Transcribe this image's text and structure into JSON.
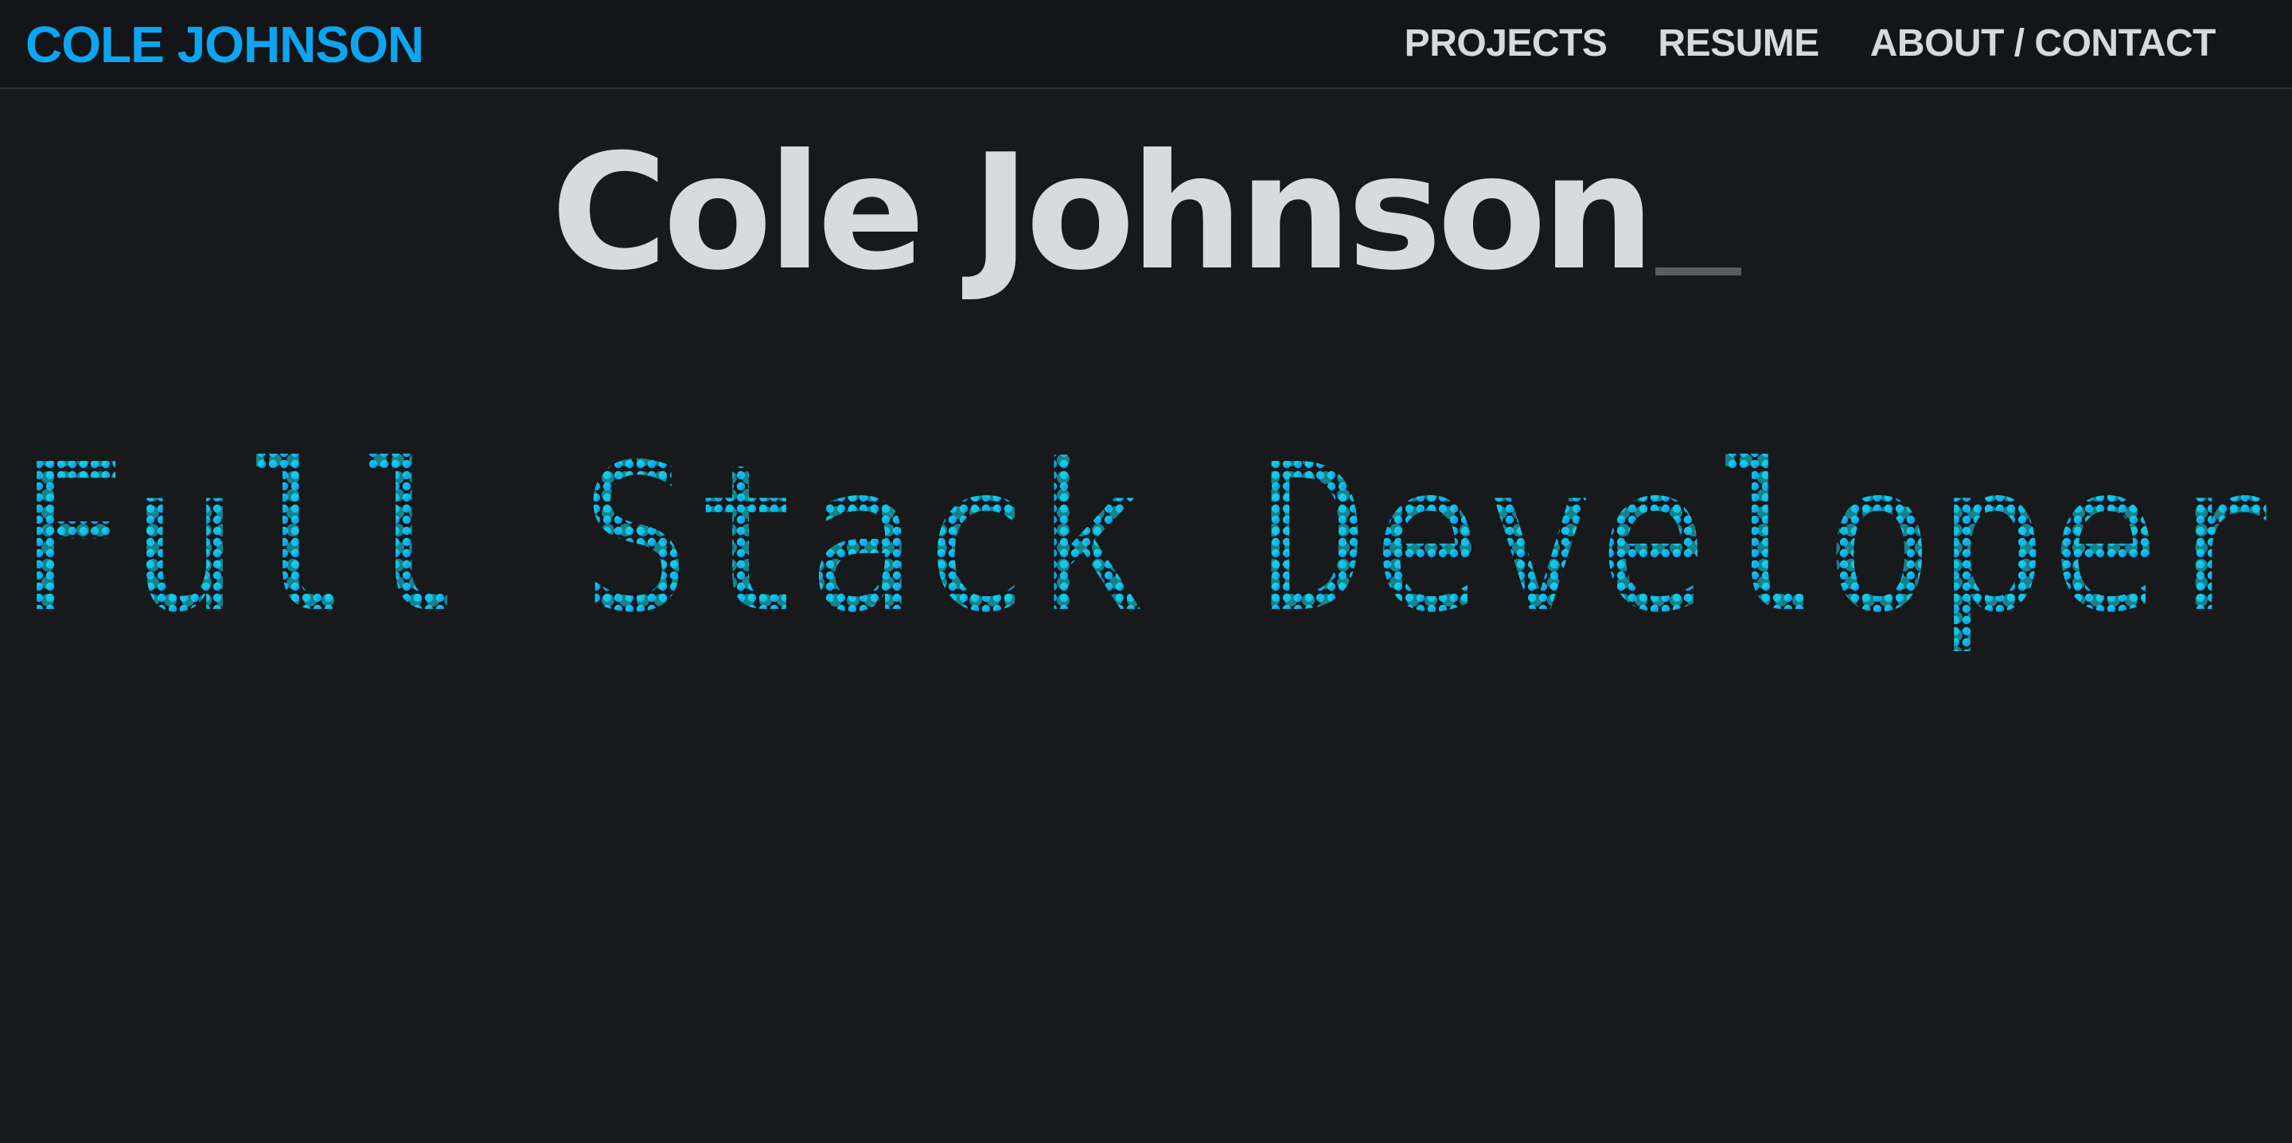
{
  "header": {
    "brand": "COLE JOHNSON",
    "nav": [
      {
        "label": "PROJECTS"
      },
      {
        "label": "RESUME"
      },
      {
        "label": "ABOUT / CONTACT"
      }
    ]
  },
  "hero": {
    "title": "Cole Johnson",
    "subtitle": "Full Stack Developer"
  },
  "colors": {
    "background": "#18191b",
    "navbar": "#131518",
    "brand": "#0ea5f0",
    "nav_text": "#d8d9de",
    "title_text": "#d9dade",
    "dot_blue": "#0a8cf0",
    "dot_cyan": "#14d9e6"
  }
}
